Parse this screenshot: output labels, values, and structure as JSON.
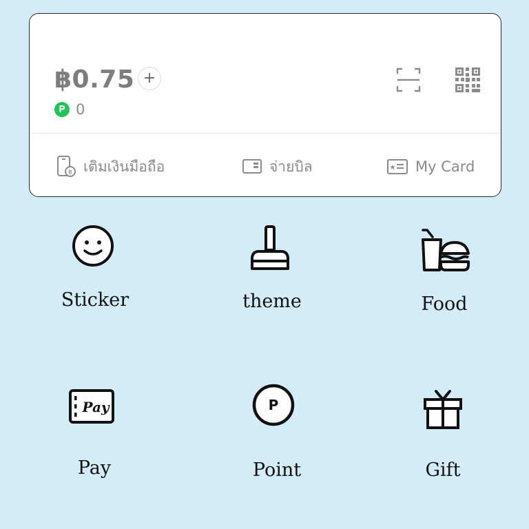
{
  "wallet": {
    "balance": "฿0.75",
    "add_label": "+",
    "points_badge": "P",
    "points": "0",
    "actions": [
      {
        "label": "เติมเงินมือถือ",
        "icon": "phone-topup-icon"
      },
      {
        "label": "จ่ายบิล",
        "icon": "bill-icon"
      },
      {
        "label": "My Card",
        "icon": "member-card-icon"
      }
    ]
  },
  "grid": [
    {
      "label": "Sticker",
      "icon": "smiley-icon"
    },
    {
      "label": "theme",
      "icon": "brush-icon"
    },
    {
      "label": "Food",
      "icon": "food-icon"
    },
    {
      "label": "Pay",
      "icon": "pay-ticket-icon"
    },
    {
      "label": "Point",
      "icon": "point-coin-icon"
    },
    {
      "label": "Gift",
      "icon": "gift-icon"
    }
  ],
  "colors": {
    "background": "#d3ecf8",
    "card": "#ffffff",
    "points_green": "#1fc455",
    "muted_text": "#8a8a8a"
  }
}
